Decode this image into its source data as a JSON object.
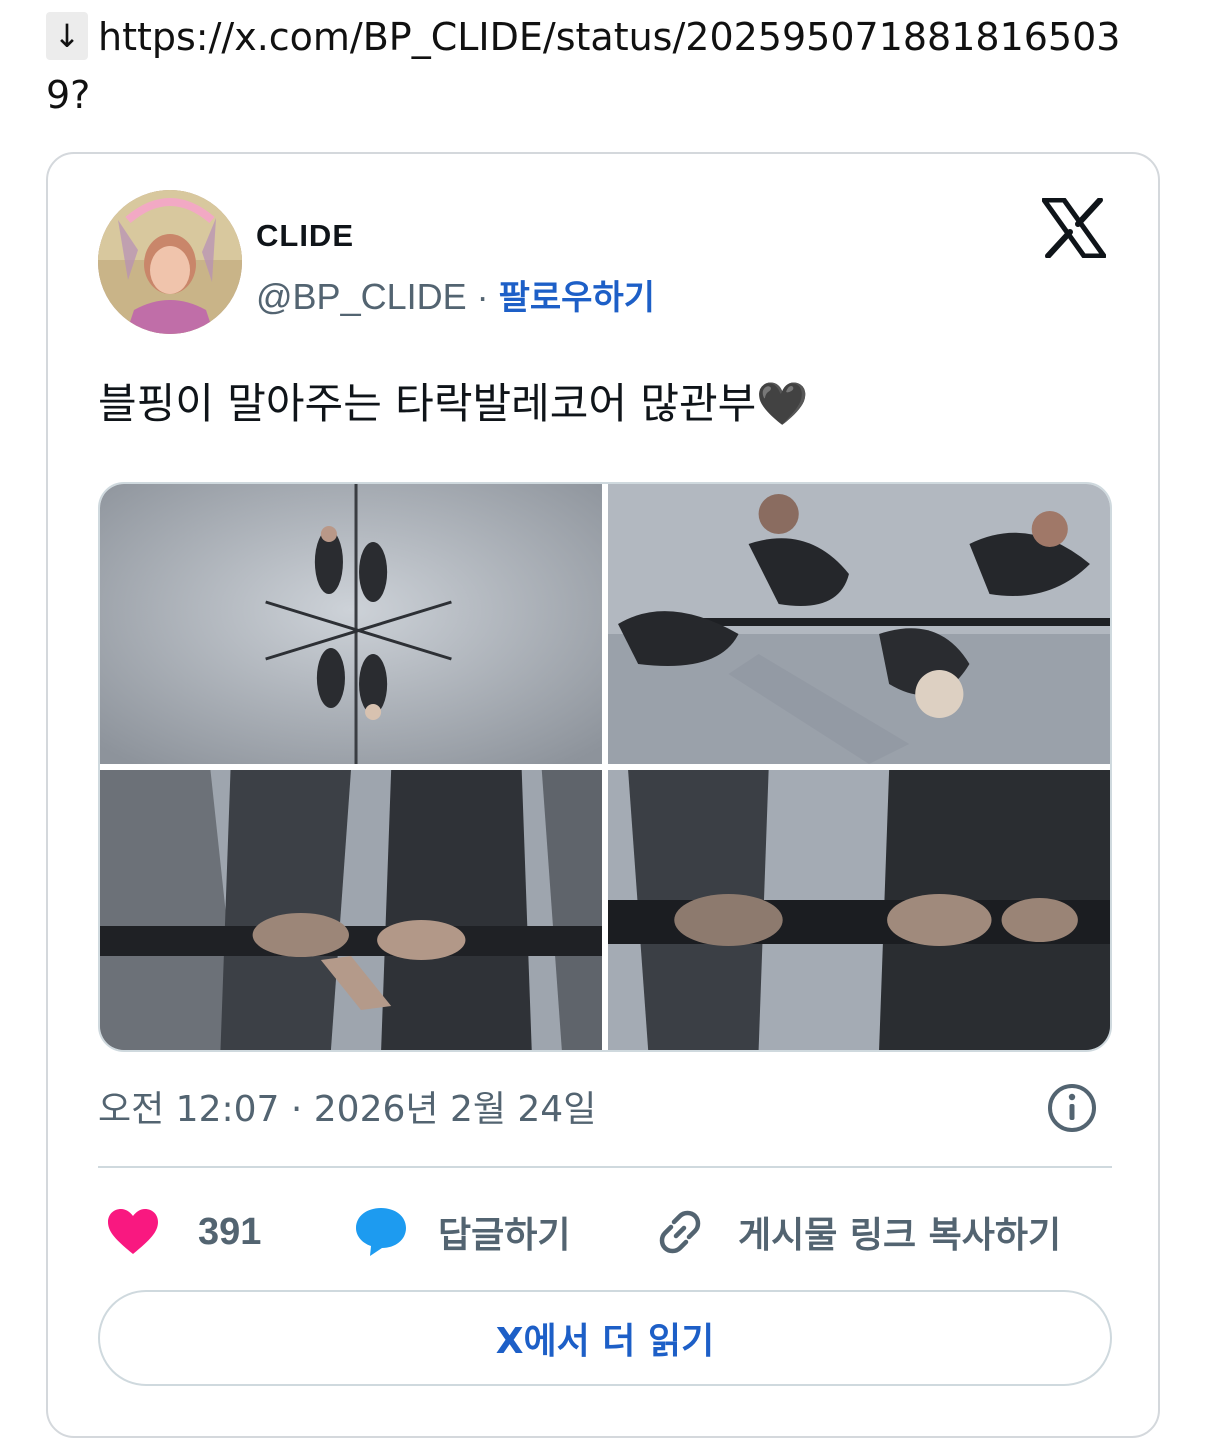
{
  "source_line": {
    "arrow": "↓",
    "url": "https://x.com/BP_CLIDE/status/202595071881816503 9?"
  },
  "tweet": {
    "display_name": "CLIDE",
    "handle": "@BP_CLIDE",
    "separator": " · ",
    "follow_label": "팔로우하기",
    "text": "블핑이 말아주는 타락발레코어 많관부",
    "heart_emoji": "🖤",
    "timestamp": "오전 12:07 · 2026년 2월 24일",
    "like_count": "391",
    "reply_label": "답글하기",
    "copy_link_label": "게시물 링크 복사하기",
    "read_more_label": "X에서 더 읽기"
  },
  "icons": {
    "x_logo": "x-logo-icon",
    "info": "info-icon",
    "like": "heart-icon",
    "reply": "speech-bubble-icon",
    "copy": "link-icon"
  },
  "colors": {
    "link_blue": "#1d5fc7",
    "heart_pink": "#f91880",
    "reply_blue": "#1d9bf0",
    "muted_gray": "#536471",
    "border_gray": "#cfd9de"
  }
}
